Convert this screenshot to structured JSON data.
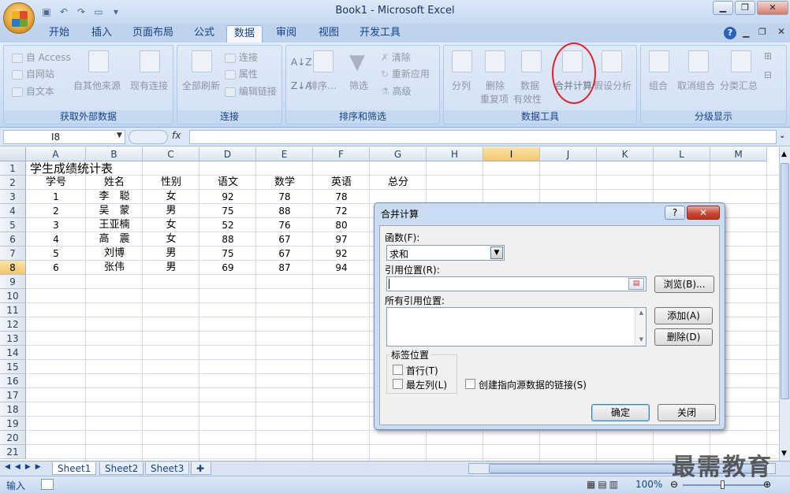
{
  "window": {
    "title": "Book1 - Microsoft Excel",
    "minimize": "▁",
    "restore": "❐",
    "close": "✕",
    "help": "?"
  },
  "tabs": [
    "开始",
    "插入",
    "页面布局",
    "公式",
    "数据",
    "审阅",
    "视图",
    "开发工具"
  ],
  "active_tab": "数据",
  "ribbon": {
    "get_external": {
      "access": "自 Access",
      "web": "自网站",
      "text": "自文本",
      "other": "自其他来源",
      "existing": "现有连接",
      "label": "获取外部数据"
    },
    "connections": {
      "refresh_all": "全部刷新",
      "connections": "连接",
      "properties": "属性",
      "edit_links": "编辑链接",
      "label": "连接"
    },
    "sort_filter": {
      "sort": "排序...",
      "filter": "筛选",
      "clear": "清除",
      "reapply": "重新应用",
      "advanced": "高级",
      "label": "排序和筛选"
    },
    "data_tools": {
      "text_to_cols": "分列",
      "remove_dup_1": "删除",
      "remove_dup_2": "重复项",
      "validation_1": "数据",
      "validation_2": "有效性",
      "consolidate": "合并计算",
      "what_if": "假设分析",
      "label": "数据工具"
    },
    "outline": {
      "group": "组合",
      "ungroup": "取消组合",
      "subtotal": "分类汇总",
      "label": "分级显示"
    }
  },
  "formula_bar": {
    "name_box": "I8",
    "fx": "fx",
    "value": ""
  },
  "columns": [
    "A",
    "B",
    "C",
    "D",
    "E",
    "F",
    "G",
    "H",
    "I",
    "J",
    "K",
    "L",
    "M"
  ],
  "selected_column": "I",
  "rows": [
    "1",
    "2",
    "3",
    "4",
    "5",
    "6",
    "7",
    "8",
    "9",
    "10",
    "11",
    "12",
    "13",
    "14",
    "15",
    "16",
    "17",
    "18",
    "19",
    "20",
    "21"
  ],
  "selected_row": "8",
  "sheet": {
    "title": "学生成绩统计表",
    "headers": [
      "学号",
      "姓名",
      "性别",
      "语文",
      "数学",
      "英语",
      "总分"
    ],
    "records": [
      [
        "1",
        "李　聪",
        "女",
        "92",
        "78",
        "78"
      ],
      [
        "2",
        "吴　蒙",
        "男",
        "75",
        "88",
        "72"
      ],
      [
        "3",
        "王亚楠",
        "女",
        "52",
        "76",
        "80"
      ],
      [
        "4",
        "高　震",
        "女",
        "88",
        "67",
        "97"
      ],
      [
        "5",
        "刘博",
        "男",
        "75",
        "67",
        "92"
      ],
      [
        "6",
        "张伟",
        "男",
        "69",
        "87",
        "94"
      ]
    ]
  },
  "sheet_tabs": [
    "Sheet1",
    "Sheet2",
    "Sheet3"
  ],
  "status": {
    "mode": "输入",
    "zoom": "100%"
  },
  "dialog": {
    "title": "合并计算",
    "function_label": "函数(F):",
    "function_value": "求和",
    "reference_label": "引用位置(R):",
    "browse": "浏览(B)...",
    "all_refs_label": "所有引用位置:",
    "add": "添加(A)",
    "delete": "删除(D)",
    "label_position": "标签位置",
    "top_row": "首行(T)",
    "left_column": "最左列(L)",
    "create_links": "创建指向源数据的链接(S)",
    "ok": "确定",
    "close": "关闭"
  },
  "watermark": "最需教育"
}
